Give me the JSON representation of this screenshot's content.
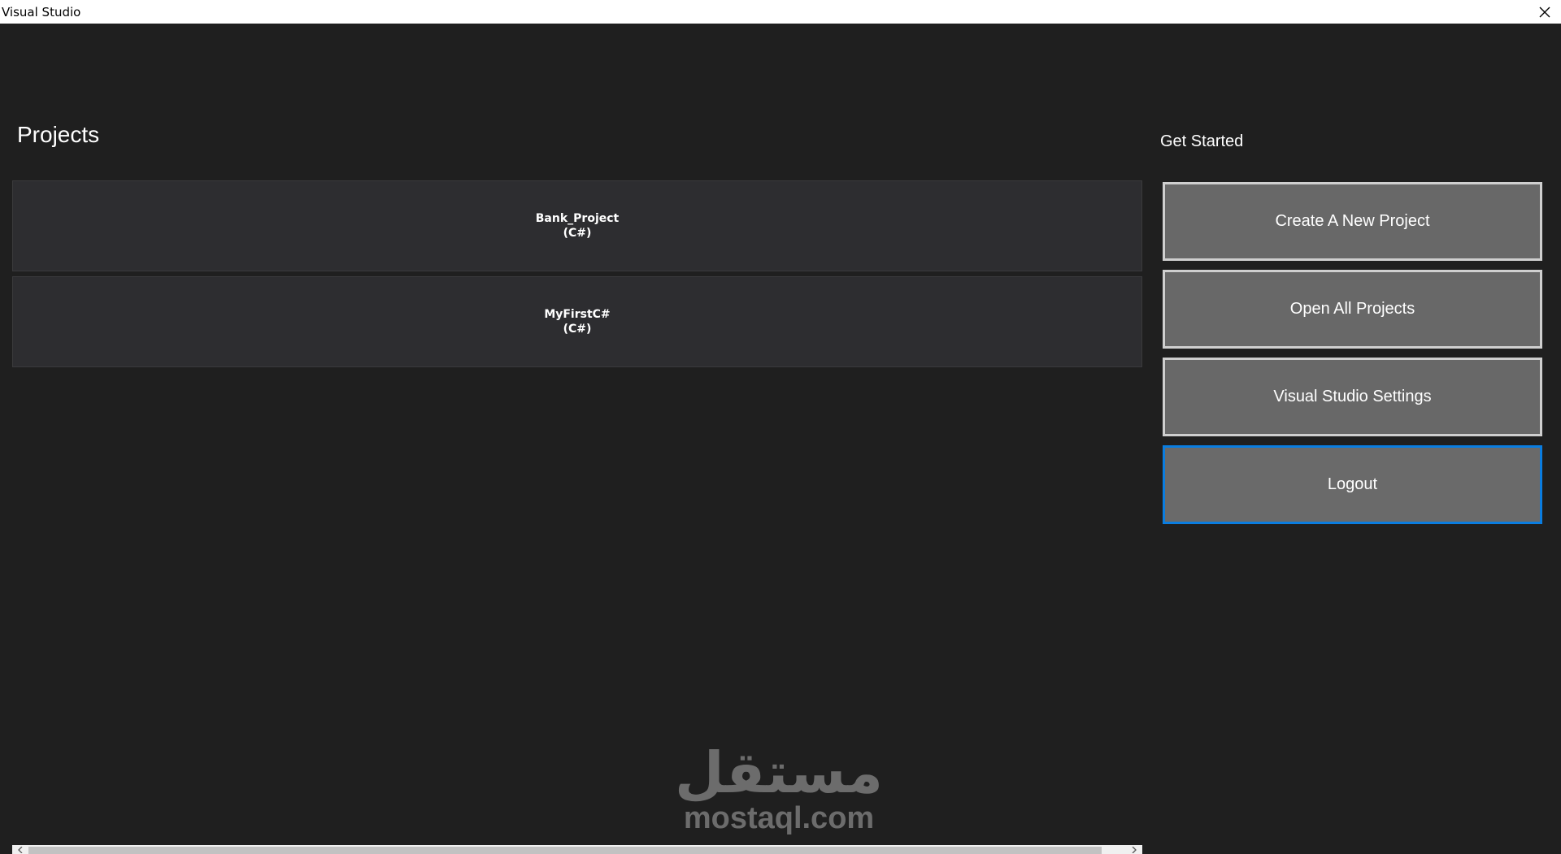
{
  "window": {
    "title": "Visual Studio"
  },
  "projects": {
    "heading": "Projects",
    "items": [
      {
        "name": "Bank_Project",
        "language": "(C#)"
      },
      {
        "name": "MyFirstC#",
        "language": "(C#)"
      }
    ]
  },
  "get_started": {
    "heading": "Get Started",
    "buttons": [
      {
        "label": "Create A New Project"
      },
      {
        "label": "Open All Projects"
      },
      {
        "label": "Visual Studio Settings"
      },
      {
        "label": "Logout"
      }
    ]
  },
  "watermark": {
    "arabic": "مستقل",
    "latin": "mostaql.com"
  },
  "icons": {
    "close": "close-icon",
    "scroll_left": "chevron-left-icon",
    "scroll_right": "chevron-right-icon"
  },
  "colors": {
    "background": "#1f1f1f",
    "button": "#686868",
    "button_border": "#cfcfcf",
    "focus_border": "#0a7de0",
    "project_bg": "#2d2d30"
  }
}
